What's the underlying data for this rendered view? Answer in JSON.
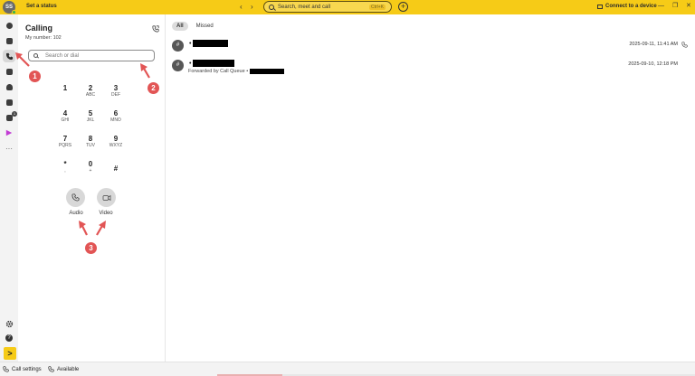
{
  "topbar": {
    "avatar_initials": "SS",
    "set_status": "Set a status",
    "search_placeholder": "Search, meet and call",
    "search_shortcut": "Ctrl+K",
    "connect_device": "Connect to a device",
    "plus_label": "+",
    "back_glyph": "‹",
    "forward_glyph": "›",
    "minimize_glyph": "—",
    "restore_glyph": "❐",
    "close_glyph": "✕"
  },
  "rail": {
    "icons": [
      "messaging-icon",
      "calendar-icon",
      "calling-icon",
      "meetings-icon",
      "teams-icon",
      "contacts-icon",
      "voicemail-icon",
      "webex-app-icon",
      "more-icon"
    ],
    "voicemail_badge": "1",
    "settings_icon": "gear-icon",
    "help_icon": "help-icon",
    "launch_glyph": ">"
  },
  "calling": {
    "title": "Calling",
    "my_number": "My number: 102",
    "search_placeholder": "Search or dial",
    "keys": [
      {
        "digit": "1",
        "letters": ""
      },
      {
        "digit": "2",
        "letters": "ABC"
      },
      {
        "digit": "3",
        "letters": "DEF"
      },
      {
        "digit": "4",
        "letters": "GHI"
      },
      {
        "digit": "5",
        "letters": "JKL"
      },
      {
        "digit": "6",
        "letters": "MNO"
      },
      {
        "digit": "7",
        "letters": "PQRS"
      },
      {
        "digit": "8",
        "letters": "TUV"
      },
      {
        "digit": "9",
        "letters": "WXYZ"
      },
      {
        "digit": "*",
        "letters": ","
      },
      {
        "digit": "0",
        "letters": "+"
      },
      {
        "digit": "#",
        "letters": ""
      }
    ],
    "audio_label": "Audio",
    "video_label": "Video"
  },
  "annotations": [
    "1",
    "2",
    "3"
  ],
  "tabs": [
    "All",
    "Missed"
  ],
  "records": [
    {
      "avatar": "#",
      "prefix": "•",
      "forwarded": "",
      "date": "2025-09-11, 11:41 AM"
    },
    {
      "avatar": "#",
      "prefix": "•",
      "forwarded": "Forwarded by Call Queue •",
      "date": "2025-09-10, 12:18 PM"
    }
  ],
  "bottombar": {
    "call_settings": "Call settings",
    "availability": "Available"
  },
  "colors": {
    "brand_yellow": "#f6cb17",
    "annotation_red": "#e25555"
  }
}
